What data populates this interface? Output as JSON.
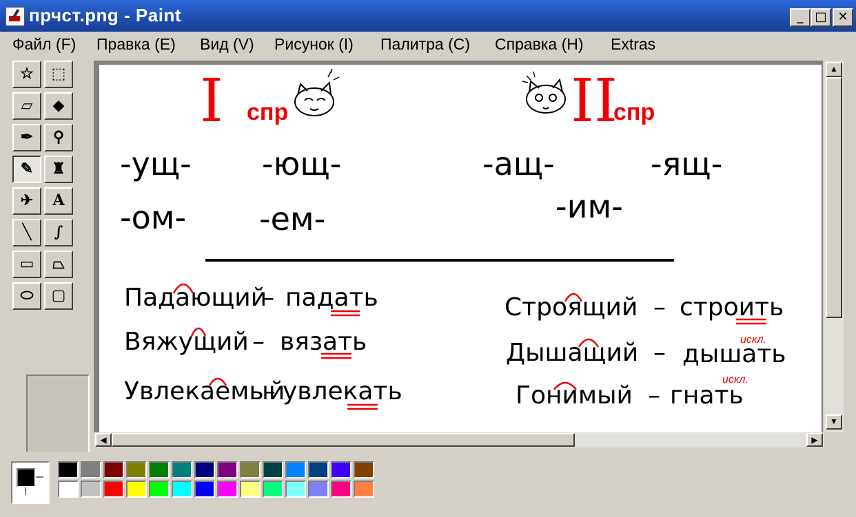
{
  "window": {
    "title": "прчст.png - Paint",
    "minimize": "_",
    "maximize": "□",
    "close": "✕"
  },
  "menu": [
    "Файл (F)",
    "Правка (E)",
    "Вид (V)",
    "Рисунок (I)",
    "Палитра (C)",
    "Справка (H)",
    "Extras"
  ],
  "tools": [
    {
      "name": "free-select-icon",
      "glyph": "☆"
    },
    {
      "name": "rect-select-icon",
      "glyph": "⬚"
    },
    {
      "name": "eraser-icon",
      "glyph": "▱"
    },
    {
      "name": "fill-bucket-icon",
      "glyph": "◆"
    },
    {
      "name": "color-picker-icon",
      "glyph": "✒"
    },
    {
      "name": "magnifier-icon",
      "glyph": "⚲"
    },
    {
      "name": "pencil-icon",
      "glyph": "✎"
    },
    {
      "name": "brush-icon",
      "glyph": "♜"
    },
    {
      "name": "airbrush-icon",
      "glyph": "✈"
    },
    {
      "name": "text-tool-icon",
      "glyph": "A"
    },
    {
      "name": "line-icon",
      "glyph": "╲"
    },
    {
      "name": "curve-icon",
      "glyph": "∫"
    },
    {
      "name": "rectangle-icon",
      "glyph": "▭"
    },
    {
      "name": "polygon-icon",
      "glyph": "⏢"
    },
    {
      "name": "ellipse-icon",
      "glyph": "⬭"
    },
    {
      "name": "rounded-rect-icon",
      "glyph": "▢"
    }
  ],
  "active_tool": "pencil-icon",
  "drawing": {
    "heading_left": {
      "numeral": "I",
      "label": "спр"
    },
    "heading_right": {
      "numeral": "II",
      "label": "спр"
    },
    "suffixes_left": [
      "-ущ-",
      "-ющ-",
      "-ом-",
      "-ем-"
    ],
    "suffixes_right": [
      "-ащ-",
      "-ящ-",
      "-им-"
    ],
    "examples_left": [
      {
        "participle": "Падающий",
        "verb": "падать"
      },
      {
        "participle": "Вяжущий",
        "verb": "вязать"
      },
      {
        "participle": "Увлекаемый",
        "verb": "увлекать"
      }
    ],
    "examples_right": [
      {
        "participle": "Строящий",
        "verb": "строить",
        "note": ""
      },
      {
        "participle": "Дышащий",
        "verb": "дышать",
        "note": "искл."
      },
      {
        "participle": "Гонимый",
        "verb": "гнать",
        "note": "искл."
      }
    ],
    "dash": "–"
  },
  "palette": {
    "foreground": "#000000",
    "background": "#ffffff",
    "row1": [
      "#000000",
      "#808080",
      "#800000",
      "#808000",
      "#008000",
      "#008080",
      "#000080",
      "#800080",
      "#808040",
      "#004040",
      "#0080ff",
      "#004080",
      "#4000ff",
      "#804000"
    ],
    "row2": [
      "#ffffff",
      "#c0c0c0",
      "#ff0000",
      "#ffff00",
      "#00ff00",
      "#00ffff",
      "#0000ff",
      "#ff00ff",
      "#ffff80",
      "#00ff80",
      "#80ffff",
      "#8080ff",
      "#ff0080",
      "#ff8040"
    ]
  }
}
